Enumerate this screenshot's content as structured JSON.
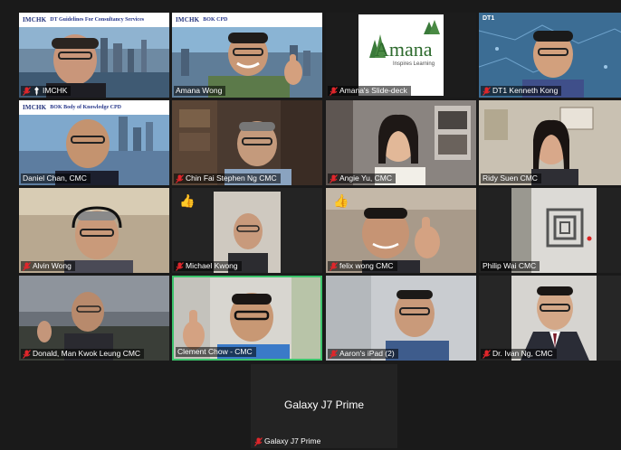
{
  "meeting": {
    "participants": [
      {
        "id": "p1",
        "name": "IMCHK",
        "muted": true,
        "extra_icon": "pin-icon",
        "banner": {
          "logo": "IMCHK",
          "text": "DT Guidelines For Consultancy Services"
        }
      },
      {
        "id": "p2",
        "name": "Amana Wong",
        "muted": false,
        "banner": {
          "logo": "IMCHK",
          "text": "BOK  CPD"
        }
      },
      {
        "id": "p3",
        "name": "Amana's Slide-deck",
        "muted": true,
        "slide": {
          "logo": "Amana",
          "tagline": "Inspires Learning"
        }
      },
      {
        "id": "p4",
        "name": "DT1 Kenneth Kong",
        "muted": true,
        "corner": "DT1"
      },
      {
        "id": "p5",
        "name": "Daniel Chan, CMC",
        "muted": false,
        "banner": {
          "logo": "IMCHK",
          "text": "BOK  Body of Knowledge  CPD"
        }
      },
      {
        "id": "p6",
        "name": "Chin Fai Stephen Ng CMC",
        "muted": true
      },
      {
        "id": "p7",
        "name": "Angie Yu, CMC",
        "muted": true
      },
      {
        "id": "p8",
        "name": "Ridy Suen CMC",
        "muted": false
      },
      {
        "id": "p9",
        "name": "Alvin Wong",
        "muted": true
      },
      {
        "id": "p10",
        "name": "Michael Kwong",
        "muted": true,
        "reaction": "👍"
      },
      {
        "id": "p11",
        "name": "felix wong CMC",
        "muted": true,
        "reaction": "👍"
      },
      {
        "id": "p12",
        "name": "Philip Wai CMC",
        "muted": false
      },
      {
        "id": "p13",
        "name": "Donald, Man Kwok Leung CMC",
        "muted": true
      },
      {
        "id": "p14",
        "name": "Clement Chow - CMC",
        "muted": false,
        "active": true
      },
      {
        "id": "p15",
        "name": "Aaron's iPad (2)",
        "muted": true
      },
      {
        "id": "p16",
        "name": "Dr. Ivan Ng, CMC",
        "muted": true
      }
    ],
    "extra_participant": {
      "display_title": "Galaxy J7 Prime",
      "name": "Galaxy J7 Prime",
      "muted": true
    }
  },
  "colors": {
    "background": "#1a1a1a",
    "muted_icon": "#e0262b",
    "active_border": "#3cc46c",
    "nameplate_text": "#ffffff"
  }
}
